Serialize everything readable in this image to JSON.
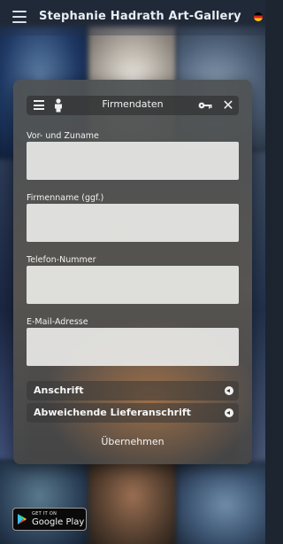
{
  "appbar": {
    "title": "Stephanie Hadrath Art-Gallery",
    "menu_icon": "hamburger-menu-icon",
    "language_icon": "german-flag-icon"
  },
  "dialog": {
    "title": "Firmendaten",
    "icons": {
      "menu": "hamburger-menu-icon",
      "person": "person-icon",
      "key": "key-icon",
      "close": "close-icon"
    },
    "fields": [
      {
        "label": "Vor- und Zuname",
        "value": ""
      },
      {
        "label": "Firmenname (ggf.)",
        "value": ""
      },
      {
        "label": "Telefon-Nummer",
        "value": ""
      },
      {
        "label": "E-Mail-Adresse",
        "value": ""
      }
    ],
    "sections": [
      {
        "label": "Anschrift"
      },
      {
        "label": "Abweichende Lieferanschrift"
      }
    ],
    "submit_label": "Übernehmen"
  },
  "store_badge": {
    "small_text": "GET IT ON",
    "big_text": "Google Play"
  },
  "colors": {
    "input_bg": "#e8e8e6",
    "dialog_bg": "#56524f",
    "text": "#f1f1f1"
  }
}
